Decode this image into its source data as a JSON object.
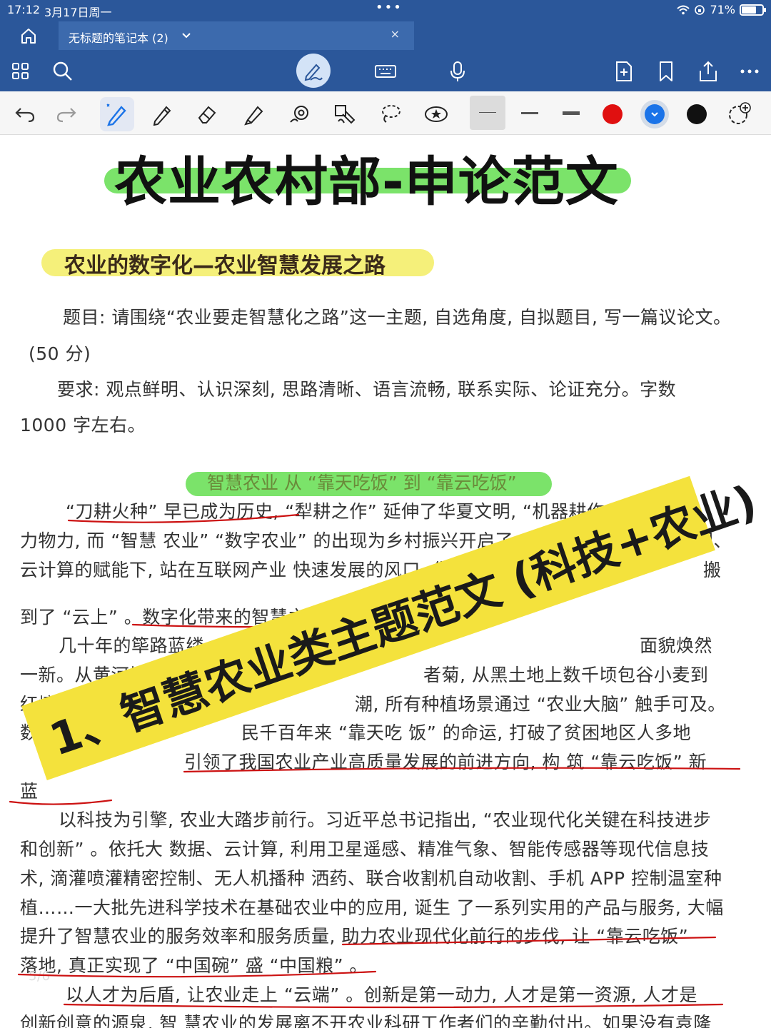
{
  "status_bar": {
    "time": "17:12",
    "date": "3月17日周一",
    "dots": "•••",
    "battery": "71%",
    "battery_level": 0.71
  },
  "tab": {
    "title": "无标题的笔记本 (2)",
    "close": "×"
  },
  "document": {
    "main_title": "农业农村部-申论范文",
    "subtitle": "农业的数字化—农业智慧发展之路",
    "question_line1": "题目: 请围绕“农业要走智慧化之路”这一主题, 自选角度, 自拟题目, 写一篇议论文。",
    "question_line2": "(50 分)",
    "requirement_line1": "要求: 观点鲜明、认识深刻, 思路清晰、语言流畅, 联系实际、论证充分。字数",
    "requirement_line2": "1000 字左右。",
    "section_head": "智慧农业 从 “靠天吃饭” 到 “靠云吃饭”",
    "lines": [
      "“刀耕火种” 早已成为历史,  “犁耕之作” 延伸了华夏文明,   “机器耕作” 节省了人",
      "力物力, 而 “智慧 农业” “数字农业” 的出现为乡村振兴开启了一扇新的窗口。在物联网、",
      "云计算的赋能下, 站在互联网产业 快速发展的风口, 借助 “农业大脑”",
      "到了 “云上” 。数字化带来的智慧之路正在引领农业走",
      "几十年的筚路蓝缕, 几十年的持之以恒",
      "一新。从黄河堤 口的大闸蟹到",
      "红壤乔木之间的林下",
      "数字化",
      "",
      "蓝",
      "以科技为引擎, 农业大踏步前行。习近平总书记指出,   “农业现代化关键在科技进步",
      "和创新” 。依托大 数据、云计算, 利用卫星遥感、精准气象、智能传感器等现代信息技",
      "术, 滴灌喷灌精密控制、无人机播种 洒药、联合收割机自动收割、手机 APP 控制温室种",
      "植……一大批先进科学技术在基础农业中的应用, 诞生 了一系列实用的产品与服务, 大幅",
      "提升了智慧农业的服务效率和服务质量, 助力农业现代化前行的步伐,  让 “靠云吃饭”",
      "落地, 真正实现了 “中国碗” 盛 “中国粮” 。",
      "以人才为后盾, 让农业走上 “云端” 。创新是第一动力, 人才是第一资源, 人才是",
      "创新创意的源泉, 智 慧农业的发展离不开农业科研工作者们的辛勤付出。如果没有袁隆"
    ],
    "right_fragments": [
      "搬",
      "面貌焕然",
      "者菊, 从黑土地上数千顷包谷小麦到",
      "潮, 所有种植场景通过 “农业大脑” 触手可及。",
      "民千百年来 “靠天吃 饭” 的命运, 打破了贫困地区人多地",
      "引领了我国农业产业高质量发展的前进方向, 构 筑 “靠云吃饭” 新"
    ],
    "stamp": "1、智慧农业类主题范文 (科技+农业)",
    "page_watermark": "5/6"
  },
  "colors": {
    "ribbon": "#2b579a",
    "highlight_green": "#7be36a",
    "highlight_yellow": "#f5f07a",
    "ink_red": "#cc1111",
    "stamp_yellow": "#f4e23c",
    "pen_red": "#e01010",
    "pen_blue": "#1a73e8",
    "pen_black": "#111111"
  }
}
